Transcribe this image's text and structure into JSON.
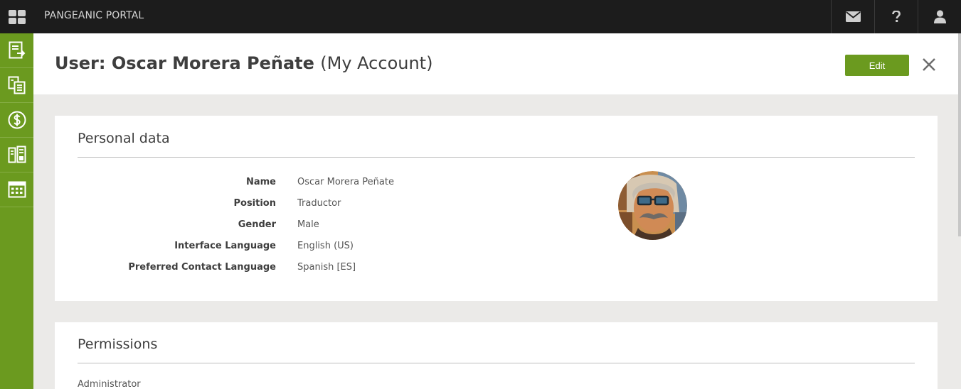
{
  "topbar": {
    "brand": "PANGEANIC PORTAL",
    "icons": [
      "apps-grid-icon",
      "envelope-icon",
      "question-icon",
      "user-icon"
    ]
  },
  "sidebar": {
    "icons": [
      "orders-icon",
      "projects-icon",
      "dollar-icon",
      "documents-icon",
      "calendar-icon"
    ]
  },
  "header": {
    "title": "User: Oscar Morera Peñate",
    "subtitle": "(My Account)",
    "edit_label": "Edit",
    "close_icon": "close-icon"
  },
  "personal": {
    "title": "Personal data",
    "fields": [
      {
        "label": "Name",
        "value": "Oscar Morera Peñate"
      },
      {
        "label": "Position",
        "value": "Traductor"
      },
      {
        "label": "Gender",
        "value": "Male"
      },
      {
        "label": "Interface Language",
        "value": "English (US)"
      },
      {
        "label": "Preferred Contact Language",
        "value": "Spanish [ES]"
      }
    ]
  },
  "permissions": {
    "title": "Permissions",
    "role": "Administrator"
  },
  "colors": {
    "accent": "#6b9a1f",
    "topbar": "#1c1c1c",
    "background": "#ebeae8"
  }
}
